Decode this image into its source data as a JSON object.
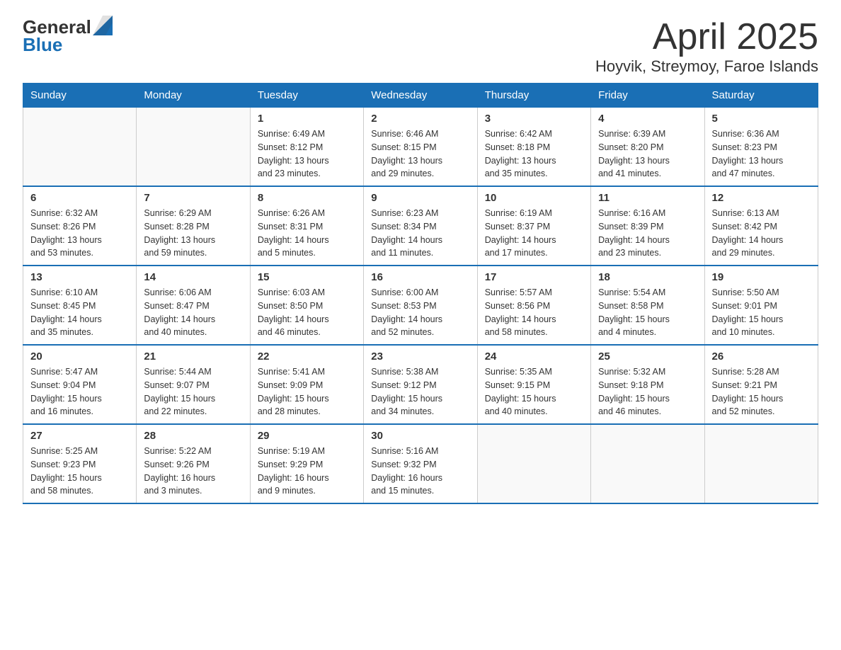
{
  "logo": {
    "general": "General",
    "blue": "Blue"
  },
  "title": "April 2025",
  "subtitle": "Hoyvik, Streymoy, Faroe Islands",
  "headers": [
    "Sunday",
    "Monday",
    "Tuesday",
    "Wednesday",
    "Thursday",
    "Friday",
    "Saturday"
  ],
  "weeks": [
    [
      {
        "day": "",
        "info": ""
      },
      {
        "day": "",
        "info": ""
      },
      {
        "day": "1",
        "info": "Sunrise: 6:49 AM\nSunset: 8:12 PM\nDaylight: 13 hours\nand 23 minutes."
      },
      {
        "day": "2",
        "info": "Sunrise: 6:46 AM\nSunset: 8:15 PM\nDaylight: 13 hours\nand 29 minutes."
      },
      {
        "day": "3",
        "info": "Sunrise: 6:42 AM\nSunset: 8:18 PM\nDaylight: 13 hours\nand 35 minutes."
      },
      {
        "day": "4",
        "info": "Sunrise: 6:39 AM\nSunset: 8:20 PM\nDaylight: 13 hours\nand 41 minutes."
      },
      {
        "day": "5",
        "info": "Sunrise: 6:36 AM\nSunset: 8:23 PM\nDaylight: 13 hours\nand 47 minutes."
      }
    ],
    [
      {
        "day": "6",
        "info": "Sunrise: 6:32 AM\nSunset: 8:26 PM\nDaylight: 13 hours\nand 53 minutes."
      },
      {
        "day": "7",
        "info": "Sunrise: 6:29 AM\nSunset: 8:28 PM\nDaylight: 13 hours\nand 59 minutes."
      },
      {
        "day": "8",
        "info": "Sunrise: 6:26 AM\nSunset: 8:31 PM\nDaylight: 14 hours\nand 5 minutes."
      },
      {
        "day": "9",
        "info": "Sunrise: 6:23 AM\nSunset: 8:34 PM\nDaylight: 14 hours\nand 11 minutes."
      },
      {
        "day": "10",
        "info": "Sunrise: 6:19 AM\nSunset: 8:37 PM\nDaylight: 14 hours\nand 17 minutes."
      },
      {
        "day": "11",
        "info": "Sunrise: 6:16 AM\nSunset: 8:39 PM\nDaylight: 14 hours\nand 23 minutes."
      },
      {
        "day": "12",
        "info": "Sunrise: 6:13 AM\nSunset: 8:42 PM\nDaylight: 14 hours\nand 29 minutes."
      }
    ],
    [
      {
        "day": "13",
        "info": "Sunrise: 6:10 AM\nSunset: 8:45 PM\nDaylight: 14 hours\nand 35 minutes."
      },
      {
        "day": "14",
        "info": "Sunrise: 6:06 AM\nSunset: 8:47 PM\nDaylight: 14 hours\nand 40 minutes."
      },
      {
        "day": "15",
        "info": "Sunrise: 6:03 AM\nSunset: 8:50 PM\nDaylight: 14 hours\nand 46 minutes."
      },
      {
        "day": "16",
        "info": "Sunrise: 6:00 AM\nSunset: 8:53 PM\nDaylight: 14 hours\nand 52 minutes."
      },
      {
        "day": "17",
        "info": "Sunrise: 5:57 AM\nSunset: 8:56 PM\nDaylight: 14 hours\nand 58 minutes."
      },
      {
        "day": "18",
        "info": "Sunrise: 5:54 AM\nSunset: 8:58 PM\nDaylight: 15 hours\nand 4 minutes."
      },
      {
        "day": "19",
        "info": "Sunrise: 5:50 AM\nSunset: 9:01 PM\nDaylight: 15 hours\nand 10 minutes."
      }
    ],
    [
      {
        "day": "20",
        "info": "Sunrise: 5:47 AM\nSunset: 9:04 PM\nDaylight: 15 hours\nand 16 minutes."
      },
      {
        "day": "21",
        "info": "Sunrise: 5:44 AM\nSunset: 9:07 PM\nDaylight: 15 hours\nand 22 minutes."
      },
      {
        "day": "22",
        "info": "Sunrise: 5:41 AM\nSunset: 9:09 PM\nDaylight: 15 hours\nand 28 minutes."
      },
      {
        "day": "23",
        "info": "Sunrise: 5:38 AM\nSunset: 9:12 PM\nDaylight: 15 hours\nand 34 minutes."
      },
      {
        "day": "24",
        "info": "Sunrise: 5:35 AM\nSunset: 9:15 PM\nDaylight: 15 hours\nand 40 minutes."
      },
      {
        "day": "25",
        "info": "Sunrise: 5:32 AM\nSunset: 9:18 PM\nDaylight: 15 hours\nand 46 minutes."
      },
      {
        "day": "26",
        "info": "Sunrise: 5:28 AM\nSunset: 9:21 PM\nDaylight: 15 hours\nand 52 minutes."
      }
    ],
    [
      {
        "day": "27",
        "info": "Sunrise: 5:25 AM\nSunset: 9:23 PM\nDaylight: 15 hours\nand 58 minutes."
      },
      {
        "day": "28",
        "info": "Sunrise: 5:22 AM\nSunset: 9:26 PM\nDaylight: 16 hours\nand 3 minutes."
      },
      {
        "day": "29",
        "info": "Sunrise: 5:19 AM\nSunset: 9:29 PM\nDaylight: 16 hours\nand 9 minutes."
      },
      {
        "day": "30",
        "info": "Sunrise: 5:16 AM\nSunset: 9:32 PM\nDaylight: 16 hours\nand 15 minutes."
      },
      {
        "day": "",
        "info": ""
      },
      {
        "day": "",
        "info": ""
      },
      {
        "day": "",
        "info": ""
      }
    ]
  ]
}
